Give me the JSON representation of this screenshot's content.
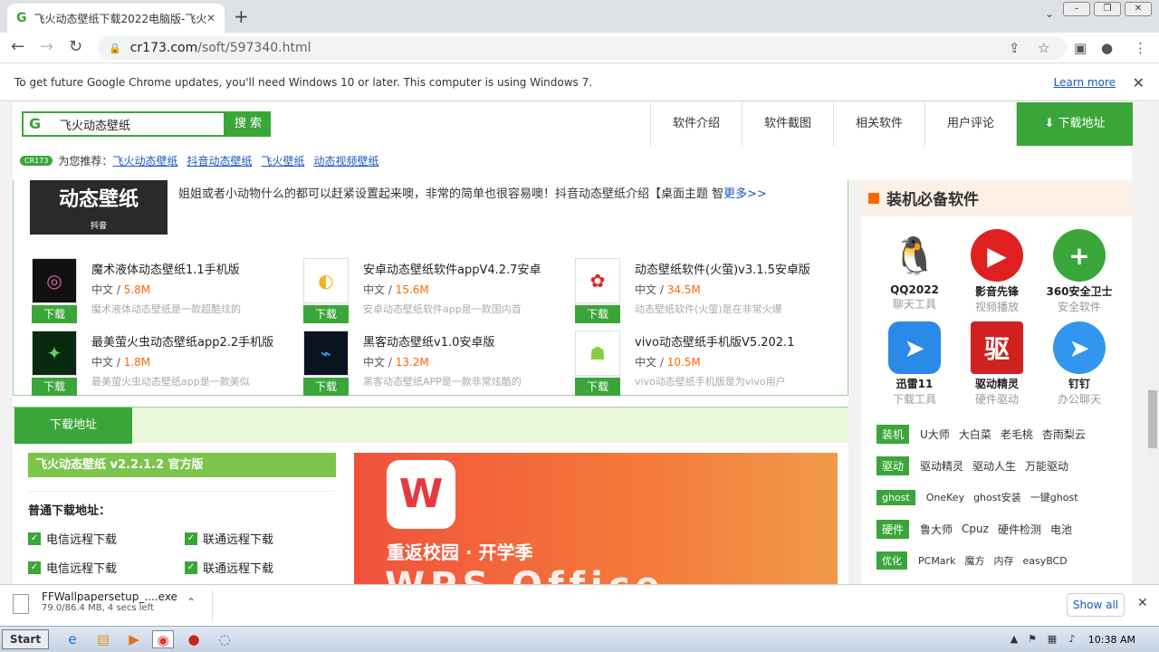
{
  "browser": {
    "tab_title": "飞火动态壁纸下载2022电脑版-飞火",
    "url_host": "cr173.com",
    "url_path": "/soft/597340.html"
  },
  "infobar": {
    "message": "To get future Google Chrome updates, you'll need Windows 10 or later. This computer is using Windows 7.",
    "learn_more": "Learn more"
  },
  "header": {
    "search_value": "飞火动态壁纸",
    "search_button": "搜 索",
    "nav_tabs": [
      "软件介绍",
      "软件截图",
      "相关软件",
      "用户评论"
    ],
    "download_tab": "下载地址",
    "rec_badge": "CR173",
    "rec_label": "为您推荐：",
    "rec_links": [
      "飞火动态壁纸",
      "抖音动态壁纸",
      "飞火壁纸",
      "动态视频壁纸"
    ]
  },
  "main": {
    "thumb_text": "动态壁纸",
    "thumb_sub": "抖音",
    "desc_text": "姐姐或者小动物什么的都可以赶紧设置起来噢，非常的简单也很容易噢！抖音动态壁纸介绍【桌面主题 智",
    "desc_more": "更多>>",
    "items": [
      {
        "name": "魔术液体动态壁纸1.1手机版",
        "lang": "中文 / ",
        "size": "5.8M",
        "summary": "魔术液体动态壁纸是一款超酷炫的",
        "btn": "下载"
      },
      {
        "name": "安卓动态壁纸软件appV4.2.7安卓",
        "lang": "中文 / ",
        "size": "15.6M",
        "summary": "安卓动态壁纸软件app是一款国内首",
        "btn": "下载"
      },
      {
        "name": "动态壁纸软件(火萤)v3.1.5安卓版",
        "lang": "中文 / ",
        "size": "34.5M",
        "summary": "动态壁纸软件(火萤)是在非常火爆",
        "btn": "下载"
      },
      {
        "name": "最美萤火虫动态壁纸app2.2手机版",
        "lang": "中文 / ",
        "size": "1.8M",
        "summary": "最美萤火虫动态壁纸app是一款美似",
        "btn": "下载"
      },
      {
        "name": "黑客动态壁纸v1.0安卓版",
        "lang": "中文 / ",
        "size": "13.2M",
        "summary": "黑客动态壁纸APP是一款非常炫酷的",
        "btn": "下载"
      },
      {
        "name": "vivo动态壁纸手机版V5.202.1",
        "lang": "中文 / ",
        "size": "10.5M",
        "summary": "vivo动态壁纸手机版是为vivo用户",
        "btn": "下载"
      }
    ],
    "dl_tab": "下载地址",
    "version_title": "飞火动态壁纸 v2.2.1.2 官方版",
    "normal_title": "普通下载地址：",
    "links": [
      "电信远程下载",
      "联通远程下载",
      "电信远程下载",
      "联通远程下载"
    ],
    "ad_logo": "W",
    "ad_slogan": "重返校园 · 开学季",
    "ad_big": "WPS Office"
  },
  "sidebar": {
    "title": "装机必备软件",
    "apps": [
      {
        "name": "QQ2022",
        "cat": "聊天工具",
        "glyph": "Q",
        "color": "#222222"
      },
      {
        "name": "影音先锋",
        "cat": "视频播放",
        "glyph": "▶",
        "color": "#e02020"
      },
      {
        "name": "360安全卫士",
        "cat": "安全软件",
        "glyph": "+",
        "color": "#3aa63a"
      },
      {
        "name": "迅雷11",
        "cat": "下载工具",
        "glyph": "➤",
        "color": "#2a8ae8"
      },
      {
        "name": "驱动精灵",
        "cat": "硬件驱动",
        "glyph": "驱",
        "color": "#d02020"
      },
      {
        "name": "钉钉",
        "cat": "办公聊天",
        "glyph": "➤",
        "color": "#3296f0"
      }
    ],
    "categories": [
      {
        "label": "装机",
        "items": [
          "U大师",
          "大白菜",
          "老毛桃",
          "杏雨梨云"
        ]
      },
      {
        "label": "驱动",
        "items": [
          "驱动精灵",
          "驱动人生",
          "万能驱动"
        ]
      },
      {
        "label": "ghost",
        "items": [
          "OneKey",
          "ghost安装",
          "一键ghost"
        ]
      },
      {
        "label": "硬件",
        "items": [
          "鲁大师",
          "Cpuz",
          "硬件检测",
          "电池"
        ]
      },
      {
        "label": "优化",
        "items": [
          "PCMark",
          "魔方",
          "内存",
          "easyBCD"
        ]
      }
    ]
  },
  "download_shelf": {
    "file_name": "FFWallpapersetup_....exe",
    "progress": "79.0/86.4 MB, 4 secs left",
    "show_all": "Show all"
  },
  "taskbar": {
    "start": "Start",
    "clock": "10:38 AM"
  }
}
